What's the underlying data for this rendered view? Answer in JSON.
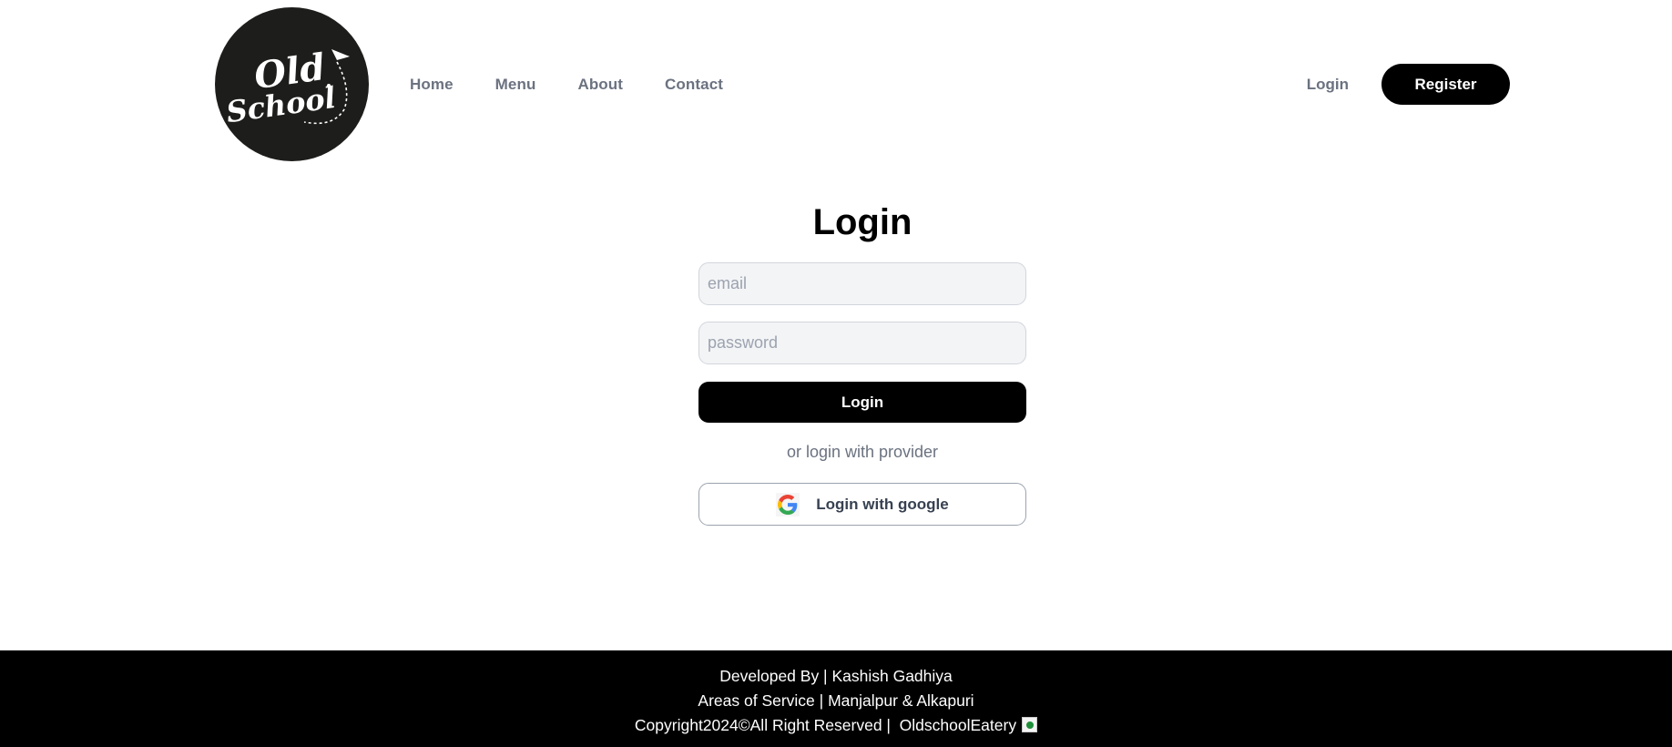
{
  "header": {
    "logo": {
      "line1": "Old",
      "line2": "School",
      "alt": "Old School logo"
    },
    "nav": [
      {
        "label": "Home"
      },
      {
        "label": "Menu"
      },
      {
        "label": "About"
      },
      {
        "label": "Contact"
      }
    ],
    "login_label": "Login",
    "register_label": "Register"
  },
  "form": {
    "title": "Login",
    "email_placeholder": "email",
    "email_value": "",
    "password_placeholder": "password",
    "password_value": "",
    "submit_label": "Login",
    "divider_text": "or login with provider",
    "google_label": "Login with google",
    "google_icon": "google-g-icon"
  },
  "footer": {
    "line1": "Developed By | Kashish Gadhiya",
    "line2": "Areas of Service | Manjalpur & Alkapuri",
    "line3": "Copyright2024©All Right Reserved |  OldschoolEatery",
    "badge_icon": "veg-mark-icon"
  },
  "colors": {
    "primary": "#000000",
    "nav_text": "#6b7280",
    "input_bg": "#f3f4f6",
    "logo_bg": "#1d1d1b",
    "veg_green": "#1f8f3a"
  }
}
